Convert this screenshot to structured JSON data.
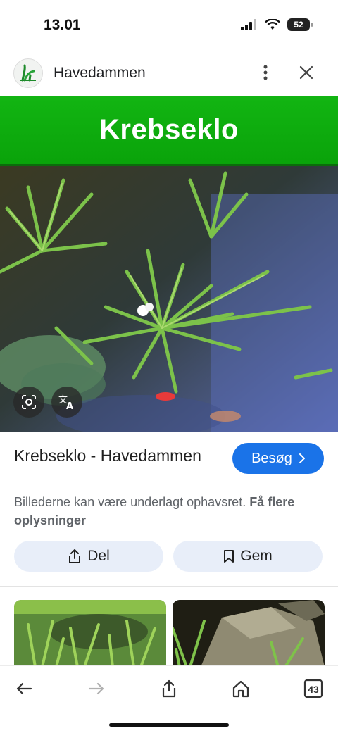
{
  "status_bar": {
    "time": "13.01",
    "battery": "52"
  },
  "header": {
    "site_name": "Havedammen"
  },
  "image": {
    "banner_text": "Krebseklo"
  },
  "result": {
    "title": "Krebseklo - Havedammen",
    "visit_label": "Besøg",
    "copyright_text": "Billederne kan være underlagt ophavsret.",
    "more_info_text": "Få flere oplysninger"
  },
  "actions": {
    "share_label": "Del",
    "save_label": "Gem"
  },
  "bottom_bar": {
    "tabs_count": "43"
  },
  "icons": {
    "more": "more-vert-icon",
    "close": "close-icon",
    "lens": "lens-icon",
    "translate": "translate-icon",
    "share": "share-icon",
    "bookmark": "bookmark-icon",
    "back": "back-arrow-icon",
    "forward": "forward-arrow-icon",
    "home": "home-icon",
    "tabs": "tabs-icon"
  },
  "colors": {
    "accent": "#1a73e8",
    "banner_green": "#0aa30a",
    "chip_bg": "#e8eef9"
  }
}
